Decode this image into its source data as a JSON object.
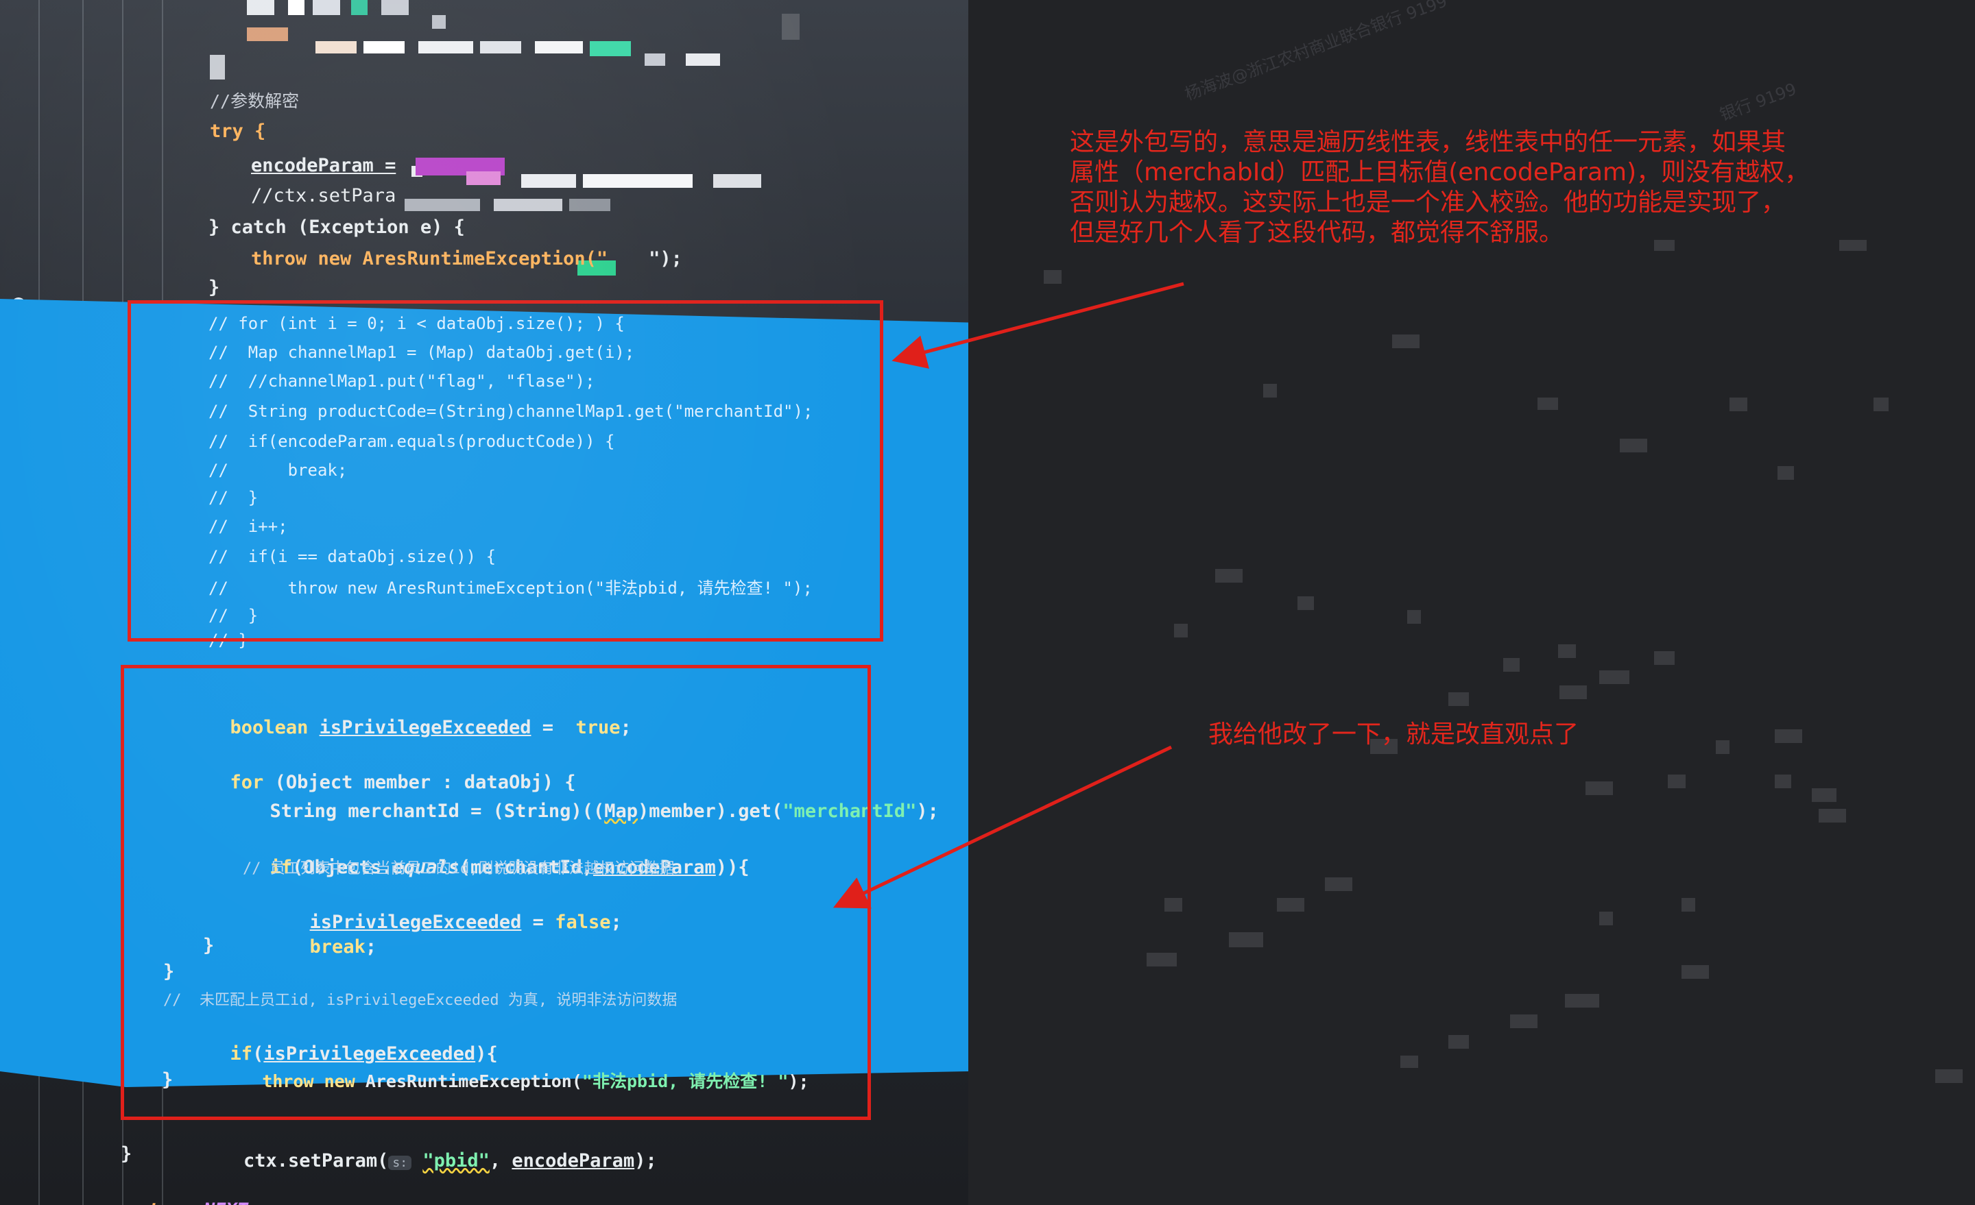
{
  "editor": {
    "top_comment": "//参数解密",
    "try_block": {
      "try_line": "try {",
      "encode_assign": "encodeParam =",
      "ctx_comment": "//ctx.setPara",
      "catch_line": "} catch (Exception e) {",
      "throw_line": "throw new AresRuntimeException(\"",
      "throw_end": "\");",
      "close": "}"
    },
    "commented_block": [
      "// for (int i = 0; i < dataObj.size(); ) {",
      "//  Map channelMap1 = (Map) dataObj.get(i);",
      "//  //channelMap1.put(\"flag\", \"flase\");",
      "//  String productCode=(String)channelMap1.get(\"merchantId\");",
      "//  if(encodeParam.equals(productCode)) {",
      "//      break;",
      "//  }",
      "//  i++;",
      "//  if(i == dataObj.size()) {",
      "//      throw new AresRuntimeException(\"非法pbid, 请先检查! \");",
      "//  }",
      "// }"
    ],
    "new_block": {
      "l1_kw": "boolean",
      "l1_var": "isPrivilegeExceeded",
      "l1_eq": " =  ",
      "l1_val": "true",
      "l1_end": ";",
      "l2_kw": "for",
      "l2_rest": " (Object member : dataObj) {",
      "l3_a": "String merchantId = (String)((",
      "l3_map": "Map",
      "l3_b": ")member).get(",
      "l3_str": "\"merchantId\"",
      "l3_c": ");",
      "l4_if": "if",
      "l4_a": "(Objects.",
      "l4_eq": "equals",
      "l4_b": "(merchantId,",
      "l4_param": "encodeParam",
      "l4_c": ")){",
      "l5_comment": "// 员工列表中包含当前员工的id,则说明没有非法越权访问数据",
      "l6_var": "isPrivilegeExceeded",
      "l6_eq": " = ",
      "l6_val": "false",
      "l6_end": ";",
      "l7_break": "break",
      "l7_end": ";",
      "l8": "}",
      "l9": "}",
      "l10_comment": "//  未匹配上员工id, isPrivilegeExceeded 为真, 说明非法访问数据",
      "l11_if": "if",
      "l11_a": "(",
      "l11_var": "isPrivilegeExceeded",
      "l11_b": "){",
      "l12_throw": "throw new",
      "l12_a": " AresRuntimeException(",
      "l12_str": "\"非法pbid, 请先检查! \"",
      "l12_b": ");",
      "l13": "}"
    },
    "after": {
      "ctx_a": "ctx.setParam(",
      "ctx_hint": "s:",
      "ctx_str": "\"pbid\"",
      "ctx_b": ", ",
      "ctx_param": "encodeParam",
      "ctx_c": ");",
      "close": "}",
      "return_kw": "return",
      "return_val": "NEXT",
      "return_end": ";"
    }
  },
  "annotations": {
    "note1": "这是外包写的，意思是遍历线性表，线性表中的任一元素，如果其\n属性（merchabId）匹配上目标值(encodeParam)，则没有越权，\n否则认为越权。这实际上也是一个准入校验。他的功能是实现了，\n但是好几个人看了这段代码，都觉得不舒服。",
    "note2": "我给他改了一下，就是改直观点了",
    "watermark1": "杨海波@浙江农村商业联合银行 9199",
    "watermark2": "银行 9199"
  },
  "colors": {
    "annotation_red": "#e3261c",
    "selection_blue": "#1798e6",
    "keyword_orange": "#ffb35c"
  },
  "icons": {
    "bulb": "lightbulb-icon"
  }
}
